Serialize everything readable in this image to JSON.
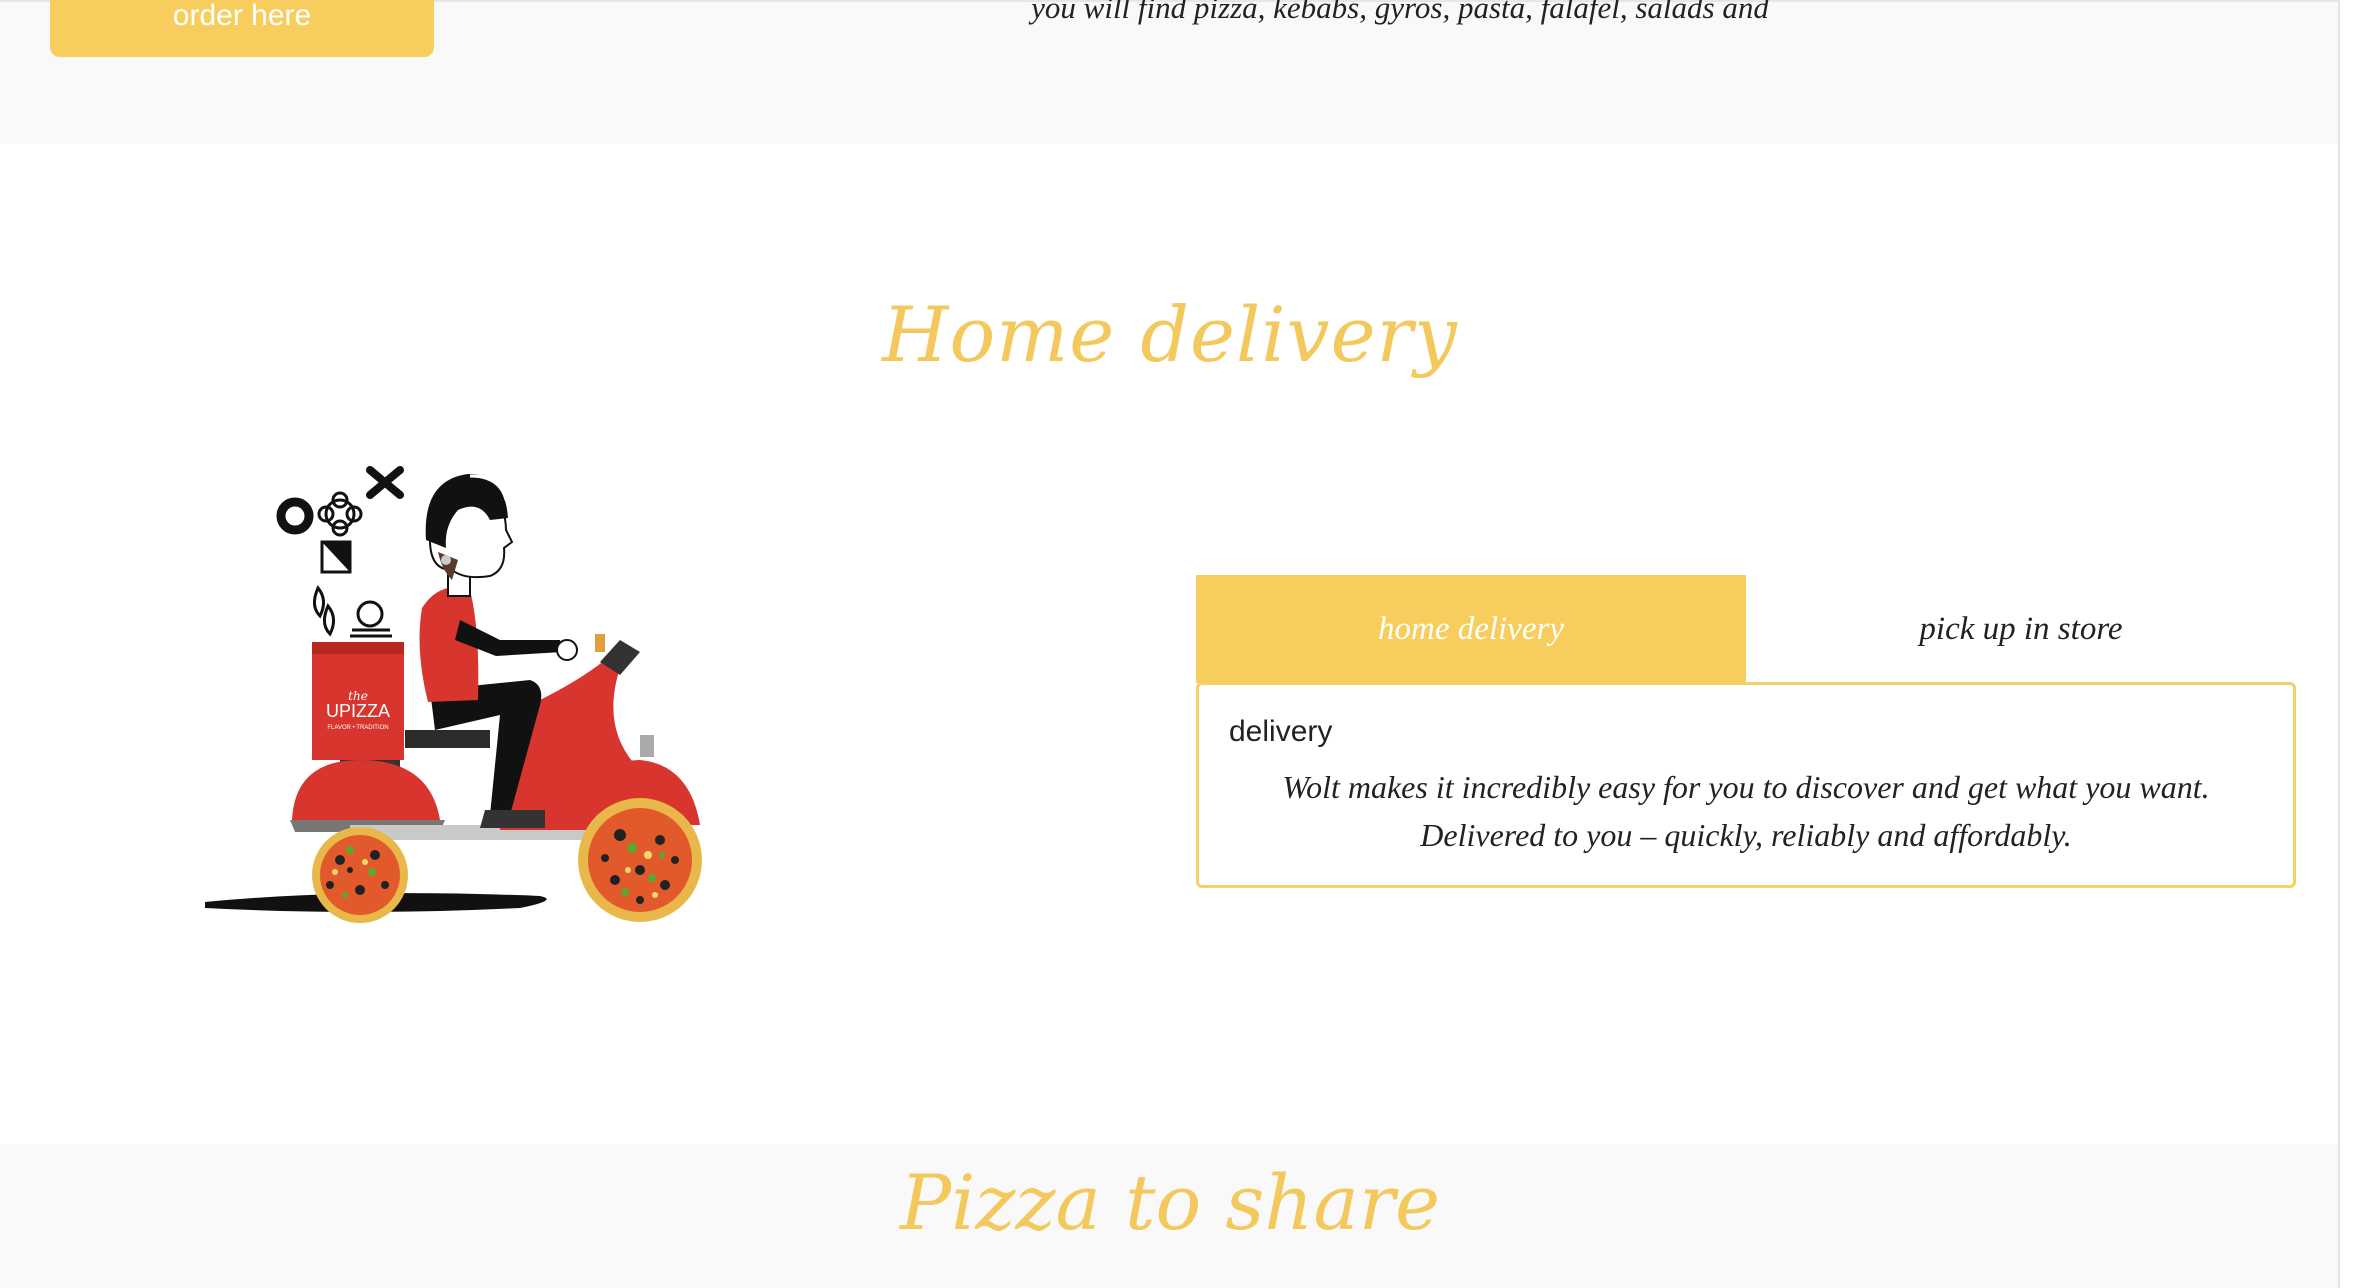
{
  "top": {
    "order_button": "order here",
    "intro_text": "you will find pizza, kebabs, gyros, pasta, falafel, salads and"
  },
  "delivery_section": {
    "title": "Home delivery",
    "illustration": {
      "box_logo": "the UPIZZA",
      "box_tagline": "FLAVOR • TRADITION"
    },
    "tabs": [
      {
        "label": "home delivery",
        "active": true
      },
      {
        "label": "pick up in store",
        "active": false
      }
    ],
    "panel": {
      "heading": "delivery",
      "line1": "Wolt makes it incredibly easy for you to discover and get what you want.",
      "line2": "Delivered to you – quickly, reliably and affordably."
    }
  },
  "share_section": {
    "title": "Pizza to share"
  },
  "colors": {
    "accent": "#f7cd5e",
    "title": "#f3c85c",
    "scooter_red": "#d8352e"
  }
}
